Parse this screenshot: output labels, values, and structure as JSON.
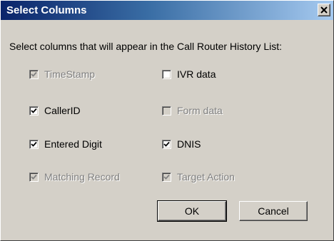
{
  "window": {
    "title": "Select Columns",
    "close_glyph": "close-x-icon"
  },
  "prompt": "Select columns that will appear in the Call Router History List:",
  "checkboxes": {
    "timestamp": {
      "label": "TimeStamp",
      "checked": true,
      "enabled": false
    },
    "ivr_data": {
      "label": "IVR data",
      "checked": false,
      "enabled": true
    },
    "caller_id": {
      "label": "CallerID",
      "checked": true,
      "enabled": true
    },
    "form_data": {
      "label": "Form data",
      "checked": false,
      "enabled": false
    },
    "entered_digit": {
      "label": "Entered Digit",
      "checked": true,
      "enabled": true
    },
    "dnis": {
      "label": "DNIS",
      "checked": true,
      "enabled": true
    },
    "matching_record": {
      "label": "Matching Record",
      "checked": true,
      "enabled": false
    },
    "target_action": {
      "label": "Target Action",
      "checked": true,
      "enabled": false
    }
  },
  "buttons": {
    "ok_label": "OK",
    "cancel_label": "Cancel"
  },
  "colors": {
    "title_start": "#0a246a",
    "title_end": "#a6caf0",
    "face": "#d4d0c8",
    "disabled_text": "#808080"
  }
}
